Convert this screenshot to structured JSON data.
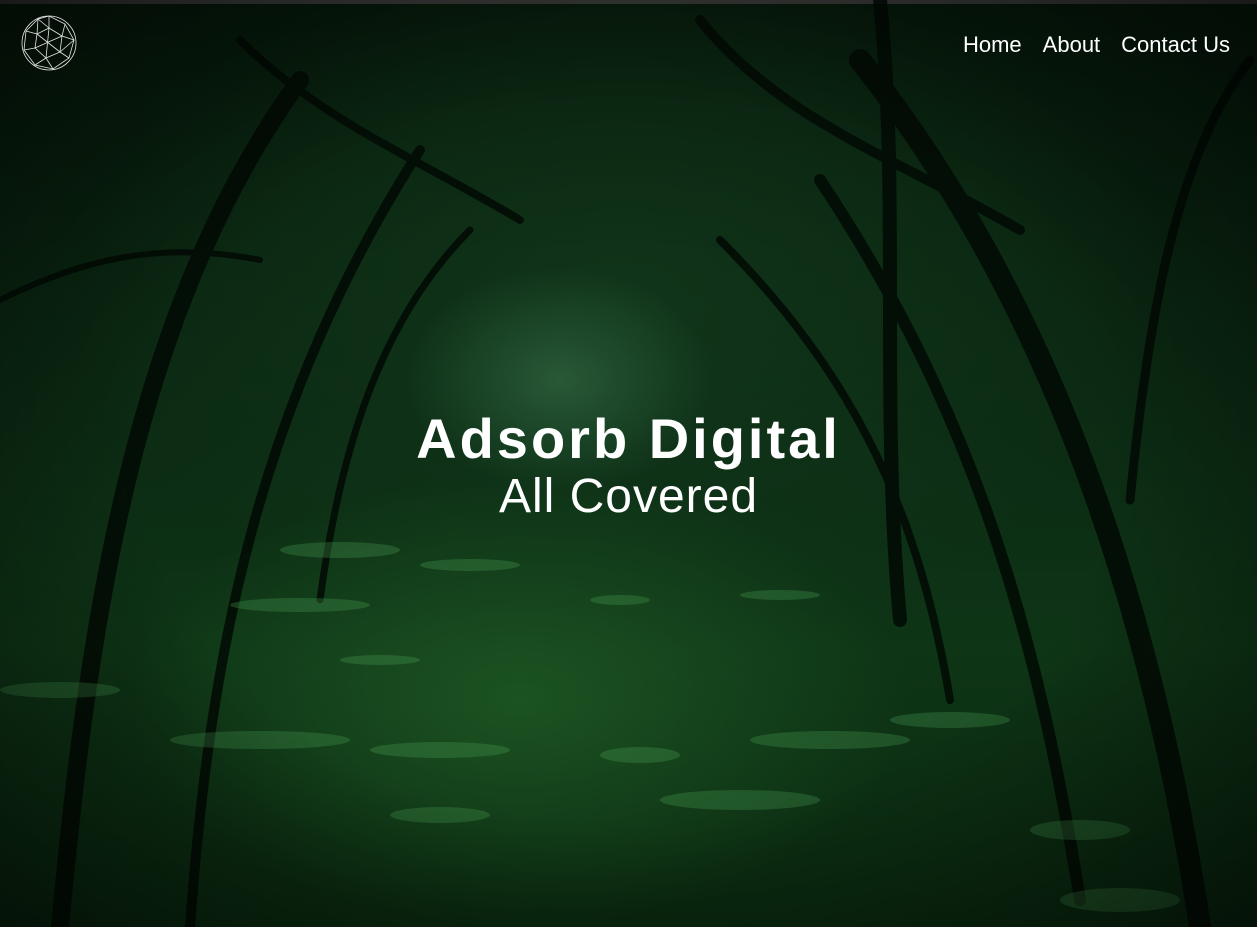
{
  "nav": {
    "items": [
      {
        "label": "Home"
      },
      {
        "label": "About"
      },
      {
        "label": "Contact Us"
      }
    ]
  },
  "hero": {
    "title": "Adsorb Digital",
    "subtitle": "All Covered"
  },
  "logo": {
    "icon": "geodesic-sphere-icon"
  },
  "colors": {
    "text": "#ffffff",
    "background_dark": "#041407",
    "foliage_green": "#2f7a3a"
  }
}
